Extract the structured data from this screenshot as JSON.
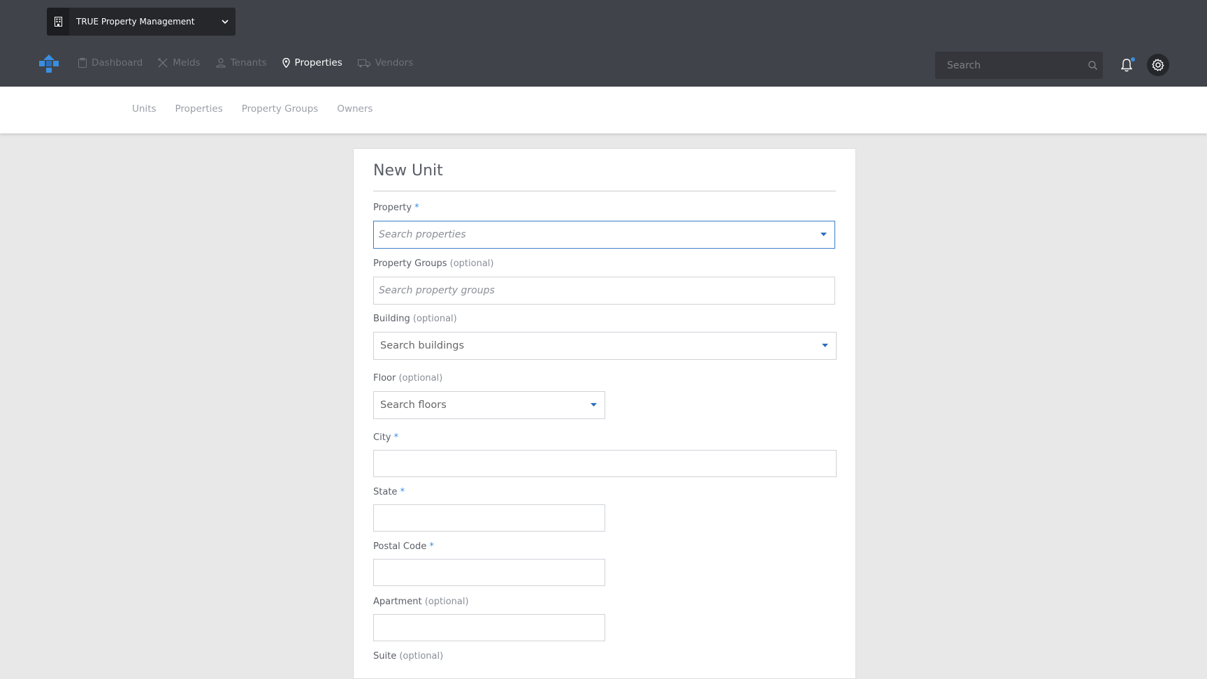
{
  "org": {
    "name": "TRUE Property Management"
  },
  "nav": [
    {
      "label": "Dashboard",
      "icon": "clipboard-icon"
    },
    {
      "label": "Melds",
      "icon": "tools-icon"
    },
    {
      "label": "Tenants",
      "icon": "person-icon"
    },
    {
      "label": "Properties",
      "icon": "map-pin-icon"
    },
    {
      "label": "Vendors",
      "icon": "truck-icon"
    }
  ],
  "active_nav": "Properties",
  "search": {
    "placeholder": "Search"
  },
  "subnav": [
    "Units",
    "Properties",
    "Property Groups",
    "Owners"
  ],
  "form": {
    "title": "New Unit",
    "property": {
      "label": "Property",
      "required": "*",
      "placeholder": "Search properties"
    },
    "property_groups": {
      "label": "Property Groups",
      "optional": "(optional)",
      "placeholder": "Search property groups"
    },
    "building": {
      "label": "Building",
      "optional": "(optional)",
      "value": "Search buildings"
    },
    "floor": {
      "label": "Floor",
      "optional": "(optional)",
      "value": "Search floors"
    },
    "city": {
      "label": "City",
      "required": "*",
      "value": ""
    },
    "state": {
      "label": "State",
      "required": "*",
      "value": ""
    },
    "postal_code": {
      "label": "Postal Code",
      "required": "*",
      "value": ""
    },
    "apartment": {
      "label": "Apartment",
      "optional": "(optional)",
      "value": ""
    },
    "suite": {
      "label": "Suite",
      "optional": "(optional)"
    }
  },
  "colors": {
    "topbar": "#404349",
    "accent": "#3a8fe0",
    "background": "#e8e8e8"
  }
}
